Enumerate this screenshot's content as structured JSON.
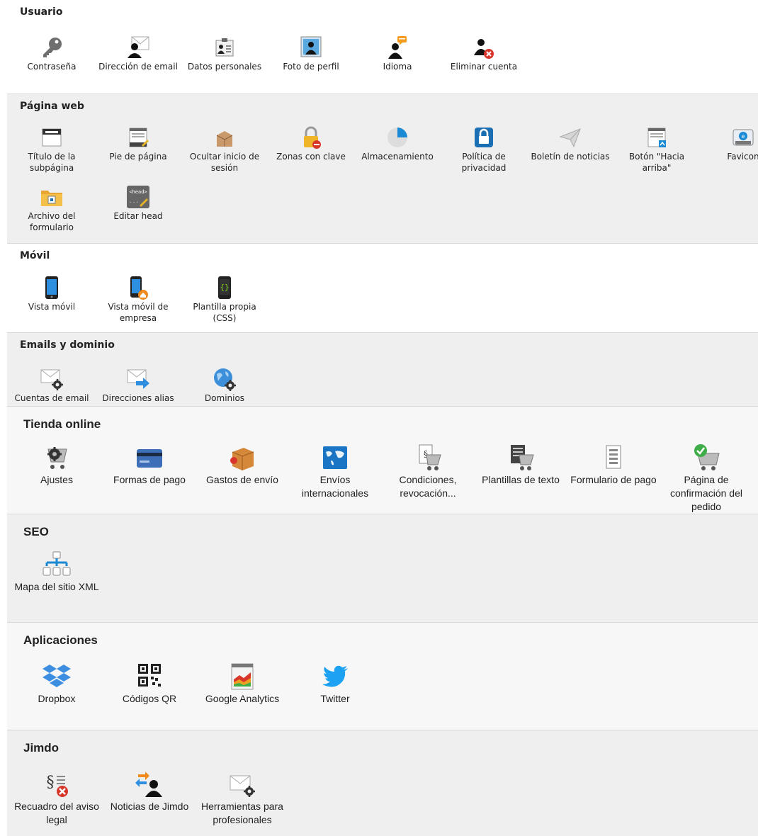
{
  "sections": {
    "usuario": {
      "title": "Usuario",
      "items": [
        "Contraseña",
        "Dirección de email",
        "Datos personales",
        "Foto de perfil",
        "Idioma",
        "Eliminar cuenta"
      ]
    },
    "pagina_web": {
      "title": "Página web",
      "items": [
        "Título de la subpágina",
        "Pie de página",
        "Ocultar inicio de sesión",
        "Zonas con clave",
        "Almacenamiento",
        "Política de privacidad",
        "Boletín de noticias",
        "Botón \"Hacia arriba\"",
        "Favicon",
        "Archivo del formulario",
        "Editar head"
      ]
    },
    "movil": {
      "title": "Móvil",
      "items": [
        "Vista móvil",
        "Vista móvil de empresa",
        "Plantilla propia (CSS)"
      ]
    },
    "emails": {
      "title": "Emails y dominio",
      "items": [
        "Cuentas de email",
        "Direcciones alias",
        "Dominios"
      ]
    },
    "tienda": {
      "title": "Tienda online",
      "items": [
        "Ajustes",
        "Formas de pago",
        "Gastos de envío",
        "Envíos internacionales",
        "Condiciones, revocación...",
        "Plantillas de texto",
        "Formulario de pago",
        "Página de confirmación del pedido"
      ]
    },
    "seo": {
      "title": "SEO",
      "items": [
        "Mapa del sitio XML"
      ]
    },
    "aplicaciones": {
      "title": "Aplicaciones",
      "items": [
        "Dropbox",
        "Códigos QR",
        "Google Analytics",
        "Twitter"
      ]
    },
    "jimdo": {
      "title": "Jimdo",
      "items": [
        "Recuadro del aviso legal",
        "Noticias de Jimdo",
        "Herramientas para profesionales"
      ]
    }
  },
  "colors": {
    "alt_bg": "#efefef",
    "light_bg": "#f7f7f7",
    "accent_blue": "#1a8ad4",
    "twitter": "#1da1f2",
    "dropbox": "#3d8ee0"
  },
  "icons": {
    "usuario": [
      "key-icon",
      "email-user-icon",
      "id-card-icon",
      "profile-photo-icon",
      "language-user-icon",
      "delete-user-icon"
    ],
    "pagina_web": [
      "subpage-title-icon",
      "footer-icon",
      "hide-login-icon",
      "lock-zone-icon",
      "storage-pie-icon",
      "privacy-lock-icon",
      "newsletter-plane-icon",
      "back-to-top-icon",
      "favicon-icon",
      "form-archive-folder-icon",
      "edit-head-icon"
    ],
    "movil": [
      "mobile-phone-icon",
      "business-mobile-icon",
      "css-phone-icon"
    ],
    "emails": [
      "email-gear-icon",
      "email-alias-arrow-icon",
      "domain-globe-icon"
    ],
    "tienda": [
      "cart-gear-icon",
      "credit-card-icon",
      "shipping-box-icon",
      "world-map-icon",
      "cart-legal-icon",
      "cart-text-icon",
      "payment-form-icon",
      "cart-check-icon"
    ],
    "seo": [
      "sitemap-icon"
    ],
    "aplicaciones": [
      "dropbox-icon",
      "qr-code-icon",
      "analytics-chart-icon",
      "twitter-bird-icon"
    ],
    "jimdo": [
      "legal-notice-icon",
      "jimdo-news-icon",
      "pro-tools-email-icon"
    ]
  }
}
